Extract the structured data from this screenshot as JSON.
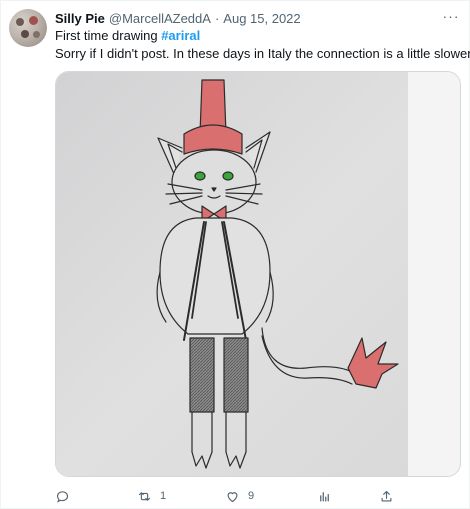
{
  "tweet": {
    "author_name": "Silly Pie",
    "author_handle": "@MarcellAZeddA",
    "separator": "·",
    "date": "Aug 15, 2022",
    "more_label": "···",
    "text_line1_prefix": "First time drawing ",
    "hashtag": "#ariral",
    "text_line2": "Sorry if I didn't post. In these days in Italy the connection is a little slower.",
    "image": {
      "icon": "drawing-photo",
      "subject": "pencil drawing of a cat character with red hat, green eyes and red-tipped tail"
    },
    "actions": {
      "reply_icon": "reply-icon",
      "reply_count": "",
      "retweet_icon": "retweet-icon",
      "retweet_count": "1",
      "like_icon": "heart-icon",
      "like_count": "9",
      "views_icon": "views-chart-icon",
      "share_icon": "share-icon"
    }
  },
  "colors": {
    "text_primary": "#0f1419",
    "text_secondary": "#536471",
    "link": "#1d9bf0",
    "border": "#cfd9de",
    "paper": "#dcdcdc",
    "red_pencil": "#d46a6a",
    "green_eyes": "#3aa63a"
  }
}
